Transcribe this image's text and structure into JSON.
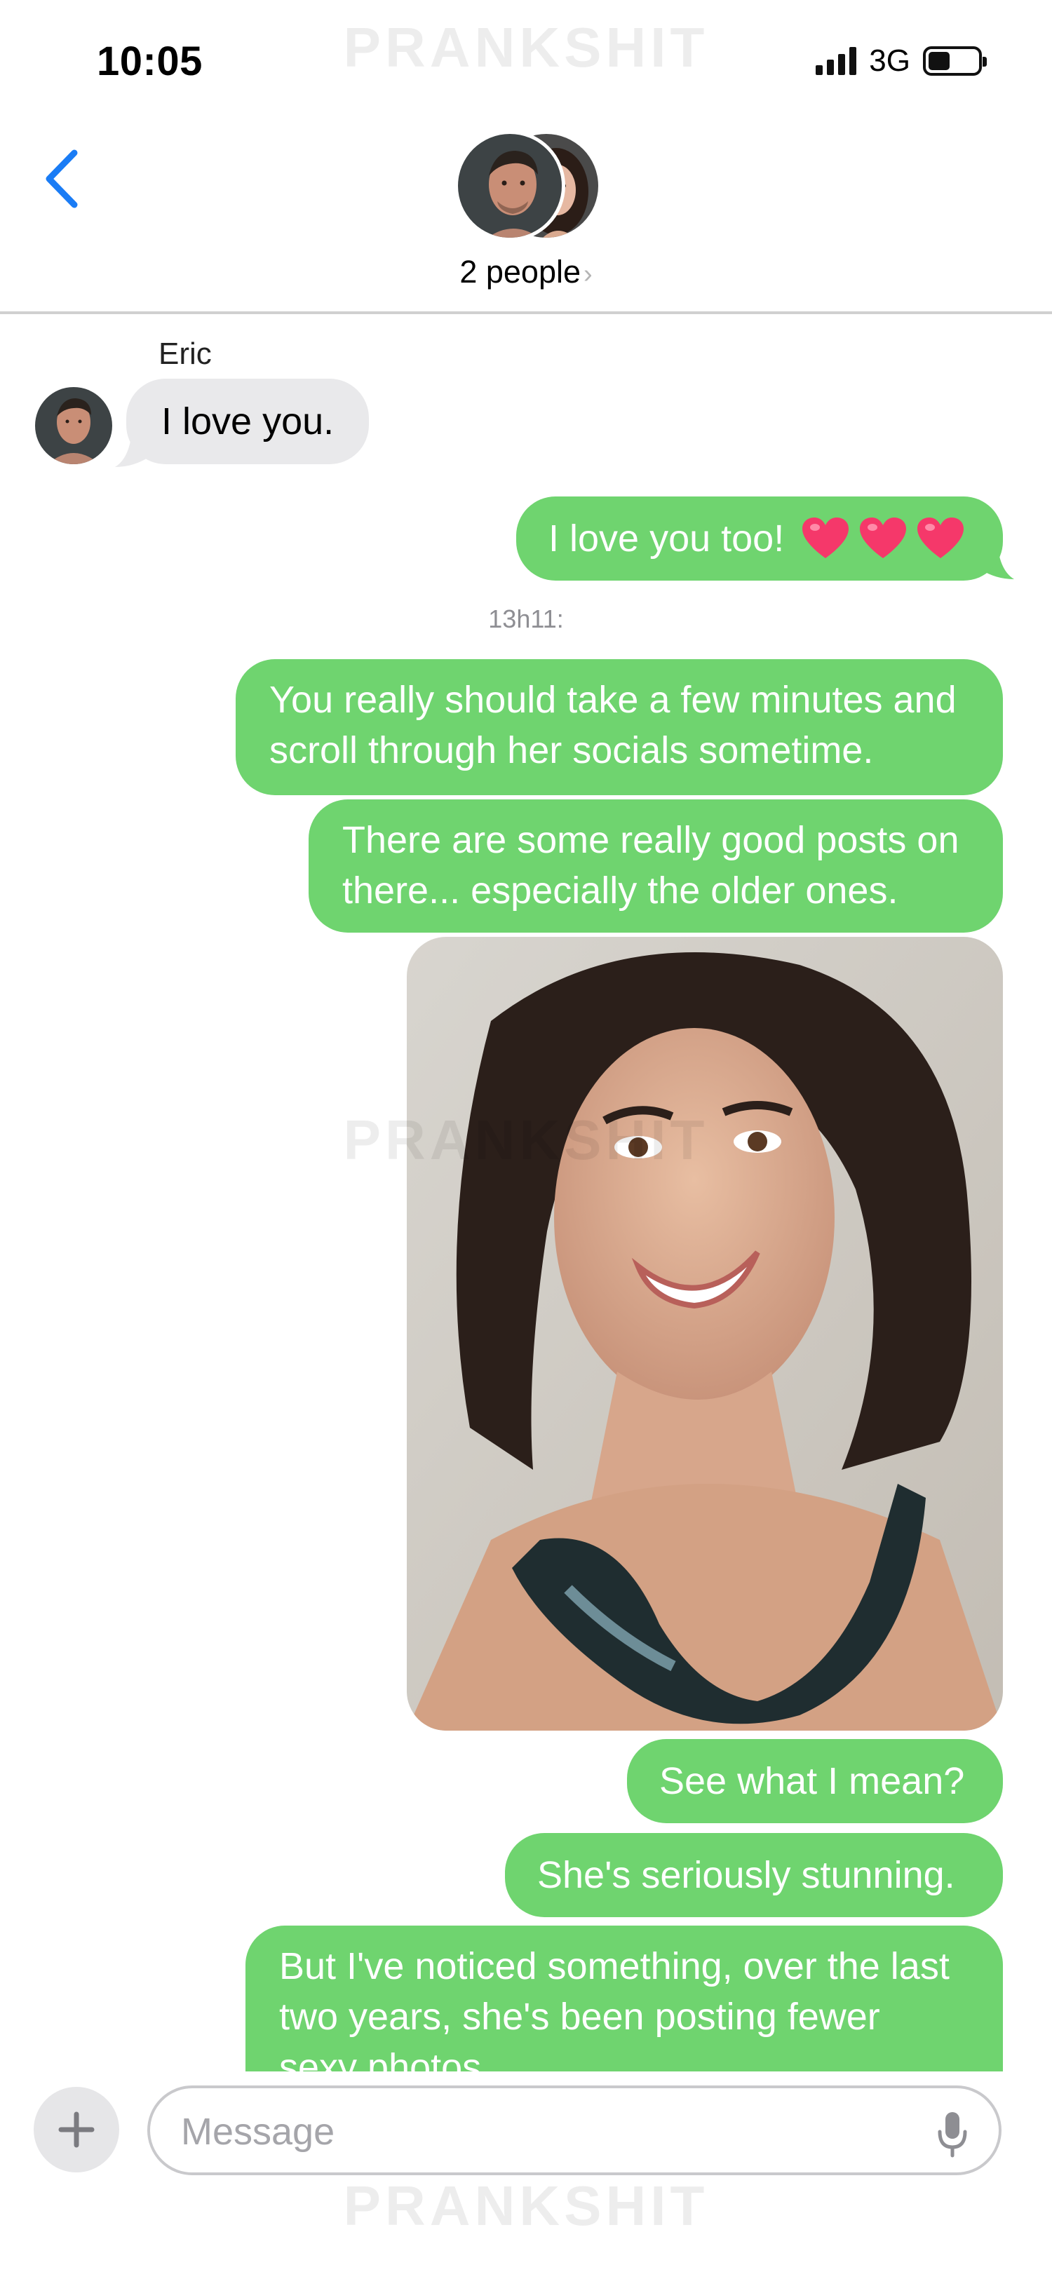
{
  "status_bar": {
    "time": "10:05",
    "network": "3G",
    "battery_level": 0.44,
    "signal_bars": 4
  },
  "watermark": "PRANKSHIT",
  "header": {
    "title": "2 people",
    "chevron": "›",
    "back_icon": "chevron-left-icon",
    "accent_color": "#1a7cf5"
  },
  "conversation": {
    "sender_name": "Eric",
    "timestamp": "13h11:",
    "incoming": [
      {
        "text": "I love you."
      }
    ],
    "outgoing": [
      {
        "text": "I love you too!",
        "emoji": "heart x3"
      },
      {
        "lines": [
          "You really should take a few minutes and",
          "scroll through her socials sometime."
        ]
      },
      {
        "lines": [
          "There are some really good posts on",
          "there... especially the older ones."
        ]
      },
      {
        "type": "photo",
        "description_icon": "photo-attachment"
      },
      {
        "text": "See what I mean?"
      },
      {
        "text": "She's seriously stunning."
      },
      {
        "lines": [
          "But I've noticed something, over the last",
          "two years, she's been posting fewer",
          "sexy photos..."
        ]
      }
    ],
    "colors": {
      "outgoing_bubble": "#6fd46f",
      "incoming_bubble": "#e9e9eb"
    }
  },
  "composer": {
    "placeholder": "Message",
    "plus_icon": "plus-icon",
    "mic_icon": "microphone-icon"
  }
}
